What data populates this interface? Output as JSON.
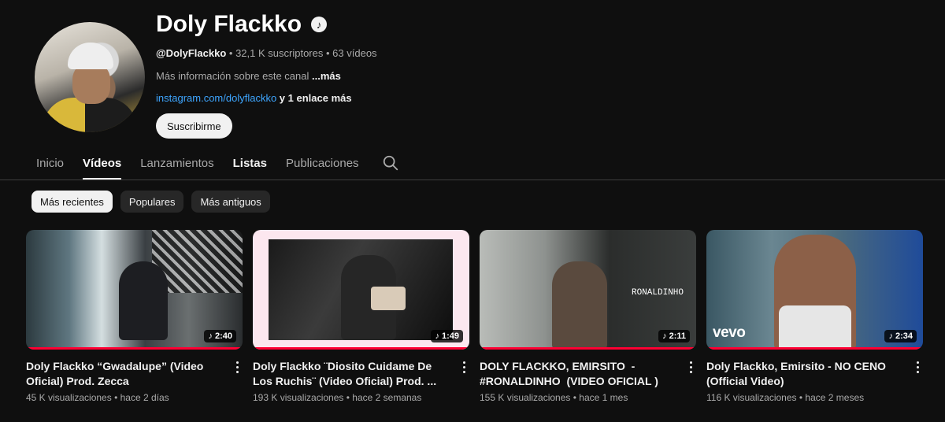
{
  "channel": {
    "name": "Doly Flackko",
    "handle": "@DolyFlackko",
    "subscribers": "32,1 K suscriptores",
    "videos_count": "63 vídeos",
    "separator": "•",
    "about_text": "Más información sobre este canal",
    "about_more": "...más",
    "link": "instagram.com/dolyflackko",
    "extra_links": "y 1 enlace más",
    "subscribe_label": "Suscribirme"
  },
  "tabs": [
    {
      "label": "Inicio"
    },
    {
      "label": "Vídeos"
    },
    {
      "label": "Lanzamientos"
    },
    {
      "label": "Listas"
    },
    {
      "label": "Publicaciones"
    }
  ],
  "chips": [
    {
      "label": "Más recientes"
    },
    {
      "label": "Populares"
    },
    {
      "label": "Más antiguos"
    }
  ],
  "videos": [
    {
      "title": "Doly Flackko “Gwadalupe” (Video Oficial) Prod. Zecca",
      "views": "45 K visualizaciones",
      "age": "hace 2 días",
      "duration": "2:40"
    },
    {
      "title": "Doly Flackko ¨Diosito Cuidame De Los Ruchis¨ (Video Oficial) Prod. ...",
      "views": "193 K visualizaciones",
      "age": "hace 2 semanas",
      "duration": "1:49"
    },
    {
      "title": "DOLY FLACKKO, EMIRSITO  - #RONALDINHO  (VIDEO OFICIAL )",
      "views": "155 K visualizaciones",
      "age": "hace 1 mes",
      "duration": "2:11",
      "overlay_text": "RONALDINHO"
    },
    {
      "title": "Doly Flackko, Emirsito - NO CENO (Official Video)",
      "views": "116 K visualizaciones",
      "age": "hace 2 meses",
      "duration": "2:34",
      "badge": "vevo"
    }
  ],
  "colors": {
    "background": "#0f0f0f",
    "link": "#3ea6ff",
    "progress": "#ff0033"
  }
}
